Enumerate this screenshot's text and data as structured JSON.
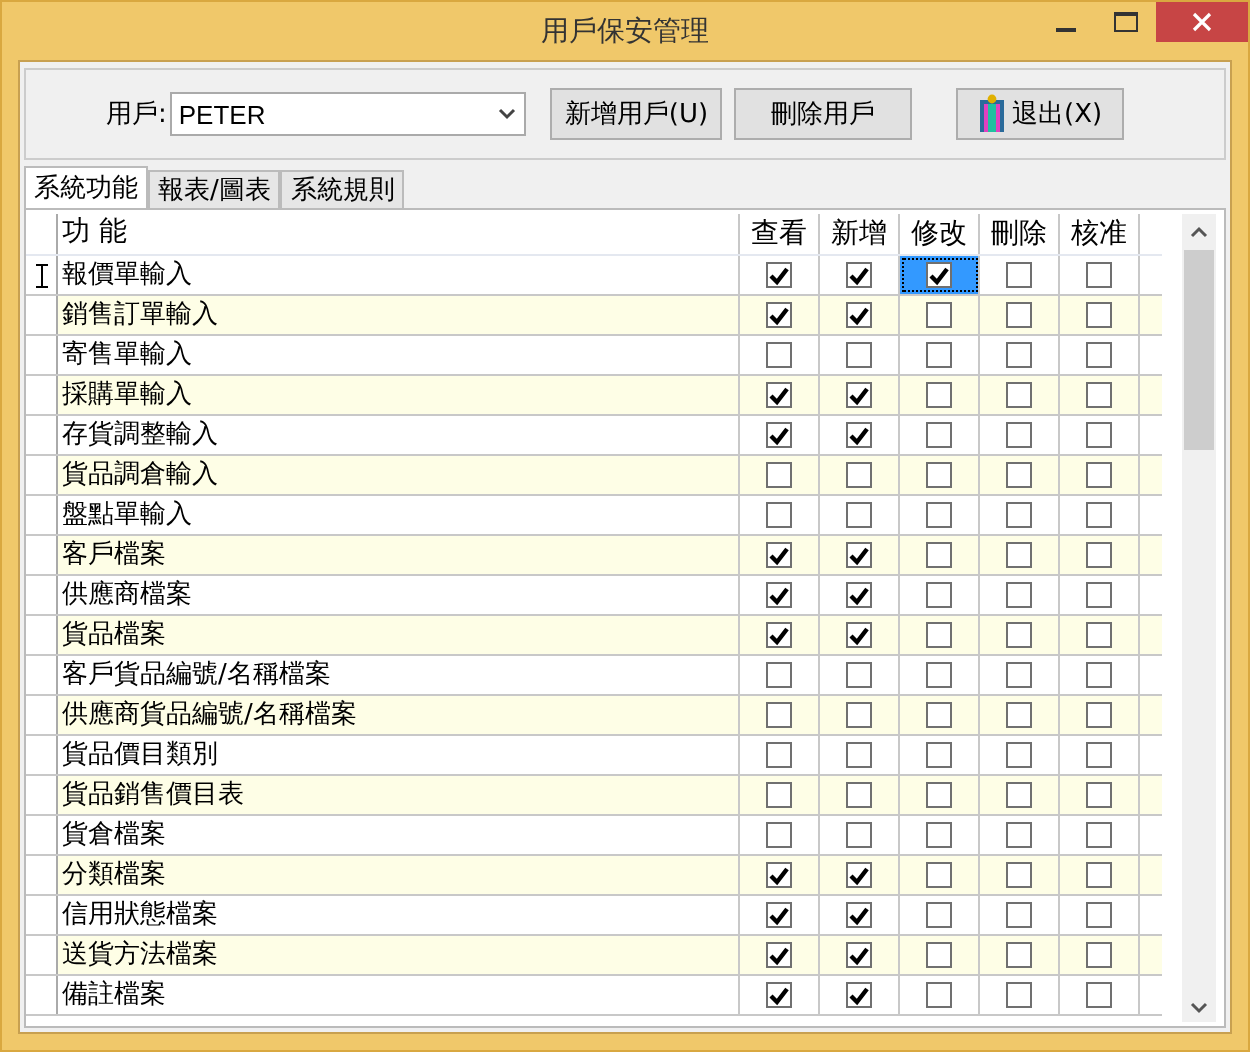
{
  "window": {
    "title": "用戶保安管理"
  },
  "user_field": {
    "label": "用戶:",
    "value": "PETER"
  },
  "buttons": [
    {
      "label": "新增用戶(U)",
      "kind": "plain"
    },
    {
      "label": "刪除用戶",
      "kind": "plain"
    },
    {
      "label": "退出(X)",
      "kind": "exit"
    }
  ],
  "tabs": [
    {
      "label": "系統功能",
      "selected": true
    },
    {
      "label": "報表/圖表",
      "selected": false
    },
    {
      "label": "系統規則",
      "selected": false
    }
  ],
  "table": {
    "columns": [
      "功 能",
      "查看",
      "新增",
      "修改",
      "刪除",
      "核准"
    ],
    "rows": [
      {
        "name": "報價單輸入",
        "current": true,
        "cells": [
          {
            "checked": true,
            "selected": false
          },
          {
            "checked": true,
            "selected": false
          },
          {
            "checked": true,
            "selected": true
          },
          {
            "checked": false,
            "selected": false
          },
          {
            "checked": false,
            "selected": false
          }
        ]
      },
      {
        "name": "銷售訂單輸入",
        "current": false,
        "cells": [
          {
            "checked": true,
            "selected": false
          },
          {
            "checked": true,
            "selected": false
          },
          {
            "checked": false,
            "selected": false
          },
          {
            "checked": false,
            "selected": false
          },
          {
            "checked": false,
            "selected": false
          }
        ]
      },
      {
        "name": "寄售單輸入",
        "current": false,
        "cells": [
          {
            "checked": false,
            "selected": false
          },
          {
            "checked": false,
            "selected": false
          },
          {
            "checked": false,
            "selected": false
          },
          {
            "checked": false,
            "selected": false
          },
          {
            "checked": false,
            "selected": false
          }
        ]
      },
      {
        "name": "採購單輸入",
        "current": false,
        "cells": [
          {
            "checked": true,
            "selected": false
          },
          {
            "checked": true,
            "selected": false
          },
          {
            "checked": false,
            "selected": false
          },
          {
            "checked": false,
            "selected": false
          },
          {
            "checked": false,
            "selected": false
          }
        ]
      },
      {
        "name": "存貨調整輸入",
        "current": false,
        "cells": [
          {
            "checked": true,
            "selected": false
          },
          {
            "checked": true,
            "selected": false
          },
          {
            "checked": false,
            "selected": false
          },
          {
            "checked": false,
            "selected": false
          },
          {
            "checked": false,
            "selected": false
          }
        ]
      },
      {
        "name": "貨品調倉輸入",
        "current": false,
        "cells": [
          {
            "checked": false,
            "selected": false
          },
          {
            "checked": false,
            "selected": false
          },
          {
            "checked": false,
            "selected": false
          },
          {
            "checked": false,
            "selected": false
          },
          {
            "checked": false,
            "selected": false
          }
        ]
      },
      {
        "name": "盤點單輸入",
        "current": false,
        "cells": [
          {
            "checked": false,
            "selected": false
          },
          {
            "checked": false,
            "selected": false
          },
          {
            "checked": false,
            "selected": false
          },
          {
            "checked": false,
            "selected": false
          },
          {
            "checked": false,
            "selected": false
          }
        ]
      },
      {
        "name": "客戶檔案",
        "current": false,
        "cells": [
          {
            "checked": true,
            "selected": false
          },
          {
            "checked": true,
            "selected": false
          },
          {
            "checked": false,
            "selected": false
          },
          {
            "checked": false,
            "selected": false
          },
          {
            "checked": false,
            "selected": false
          }
        ]
      },
      {
        "name": "供應商檔案",
        "current": false,
        "cells": [
          {
            "checked": true,
            "selected": false
          },
          {
            "checked": true,
            "selected": false
          },
          {
            "checked": false,
            "selected": false
          },
          {
            "checked": false,
            "selected": false
          },
          {
            "checked": false,
            "selected": false
          }
        ]
      },
      {
        "name": "貨品檔案",
        "current": false,
        "cells": [
          {
            "checked": true,
            "selected": false
          },
          {
            "checked": true,
            "selected": false
          },
          {
            "checked": false,
            "selected": false
          },
          {
            "checked": false,
            "selected": false
          },
          {
            "checked": false,
            "selected": false
          }
        ]
      },
      {
        "name": "客戶貨品編號/名稱檔案",
        "current": false,
        "cells": [
          {
            "checked": false,
            "selected": false
          },
          {
            "checked": false,
            "selected": false
          },
          {
            "checked": false,
            "selected": false
          },
          {
            "checked": false,
            "selected": false
          },
          {
            "checked": false,
            "selected": false
          }
        ]
      },
      {
        "name": "供應商貨品編號/名稱檔案",
        "current": false,
        "cells": [
          {
            "checked": false,
            "selected": false
          },
          {
            "checked": false,
            "selected": false
          },
          {
            "checked": false,
            "selected": false
          },
          {
            "checked": false,
            "selected": false
          },
          {
            "checked": false,
            "selected": false
          }
        ]
      },
      {
        "name": "貨品價目類別",
        "current": false,
        "cells": [
          {
            "checked": false,
            "selected": false
          },
          {
            "checked": false,
            "selected": false
          },
          {
            "checked": false,
            "selected": false
          },
          {
            "checked": false,
            "selected": false
          },
          {
            "checked": false,
            "selected": false
          }
        ]
      },
      {
        "name": "貨品銷售價目表",
        "current": false,
        "cells": [
          {
            "checked": false,
            "selected": false
          },
          {
            "checked": false,
            "selected": false
          },
          {
            "checked": false,
            "selected": false
          },
          {
            "checked": false,
            "selected": false
          },
          {
            "checked": false,
            "selected": false
          }
        ]
      },
      {
        "name": "貨倉檔案",
        "current": false,
        "cells": [
          {
            "checked": false,
            "selected": false
          },
          {
            "checked": false,
            "selected": false
          },
          {
            "checked": false,
            "selected": false
          },
          {
            "checked": false,
            "selected": false
          },
          {
            "checked": false,
            "selected": false
          }
        ]
      },
      {
        "name": "分類檔案",
        "current": false,
        "cells": [
          {
            "checked": true,
            "selected": false
          },
          {
            "checked": true,
            "selected": false
          },
          {
            "checked": false,
            "selected": false
          },
          {
            "checked": false,
            "selected": false
          },
          {
            "checked": false,
            "selected": false
          }
        ]
      },
      {
        "name": "信用狀態檔案",
        "current": false,
        "cells": [
          {
            "checked": true,
            "selected": false
          },
          {
            "checked": true,
            "selected": false
          },
          {
            "checked": false,
            "selected": false
          },
          {
            "checked": false,
            "selected": false
          },
          {
            "checked": false,
            "selected": false
          }
        ]
      },
      {
        "name": "送貨方法檔案",
        "current": false,
        "cells": [
          {
            "checked": true,
            "selected": false
          },
          {
            "checked": true,
            "selected": false
          },
          {
            "checked": false,
            "selected": false
          },
          {
            "checked": false,
            "selected": false
          },
          {
            "checked": false,
            "selected": false
          }
        ]
      },
      {
        "name": "備註檔案",
        "current": false,
        "cells": [
          {
            "checked": true,
            "selected": false
          },
          {
            "checked": true,
            "selected": false
          },
          {
            "checked": false,
            "selected": false
          },
          {
            "checked": false,
            "selected": false
          },
          {
            "checked": false,
            "selected": false
          }
        ]
      }
    ]
  }
}
